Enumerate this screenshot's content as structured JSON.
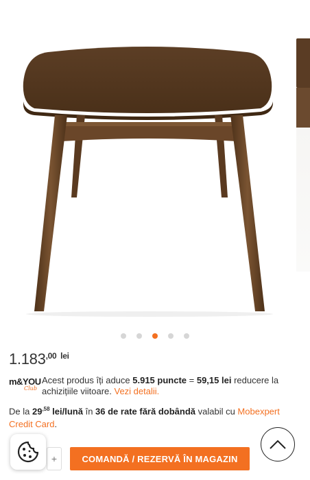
{
  "gallery": {
    "image_alt": "table product image",
    "slide_count": 5,
    "active_slide": 3
  },
  "price": {
    "integer": "1.183",
    "decimals": ",00",
    "currency": "lei"
  },
  "loyalty": {
    "logo_text": "m&YOU",
    "logo_sub": "Club",
    "text_prefix": "Acest produs îți aduce ",
    "points": "5.915 puncte",
    "equals": " = ",
    "value": "59,15 lei",
    "text_suffix": " reducere la achizițiile viitoare. ",
    "link": "Vezi detalii."
  },
  "installment": {
    "prefix": "De la ",
    "amount_int": "29",
    "amount_dec": ",58",
    "unit": " lei/lună",
    "middle": " în ",
    "rates": "36 de rate fără dobândă",
    "suffix": " valabil cu ",
    "card_link": "Mobexpert Credit Card",
    "end": "."
  },
  "actions": {
    "qty_plus": "+",
    "order_button": "COMANDĂ / REZERVĂ ÎN MAGAZIN"
  },
  "colors": {
    "accent": "#f37021",
    "wood": "#5a3c24"
  },
  "icons": {
    "cookie": "cookie-icon",
    "scroll_top": "chevron-up-icon"
  }
}
